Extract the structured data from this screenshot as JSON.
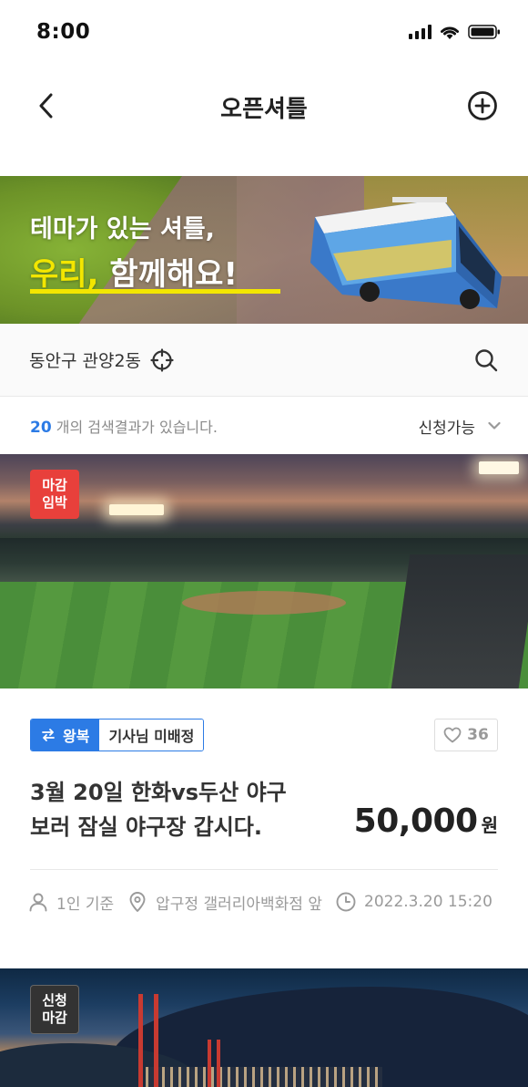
{
  "status": {
    "time": "8:00"
  },
  "nav": {
    "title": "오픈셔틀"
  },
  "banner": {
    "line1": "테마가 있는 셔틀,",
    "line2_highlight": "우리,",
    "line2_rest": " 함께해요!"
  },
  "location": {
    "label": "동안구 관양2동"
  },
  "results": {
    "count": "20",
    "text": " 개의 검색결과가 있습니다.",
    "filter_label": "신청가능"
  },
  "cards": [
    {
      "badge_line1": "마감",
      "badge_line2": "임박",
      "trip_type": "왕복",
      "driver_status": "기사님 미배정",
      "likes": "36",
      "title": "3월 20일 한화vs두산 야구 보러 잠실 야구장 갑시다.",
      "price": "50,000",
      "price_unit": "원",
      "per_person": "1인 기준",
      "place": "압구정 갤러리아백화점 앞",
      "datetime": "2022.3.20 15:20"
    },
    {
      "badge_line1": "신청",
      "badge_line2": "마감"
    }
  ],
  "colors": {
    "accent": "#2c7be5",
    "urgent": "#e8403b",
    "highlight": "#f3e600"
  }
}
